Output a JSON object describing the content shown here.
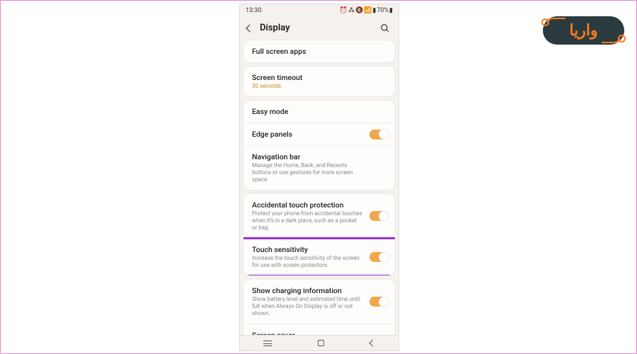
{
  "logo_text": "واریا",
  "status": {
    "time": "13:30",
    "battery": "70%"
  },
  "header": {
    "title": "Display"
  },
  "groups": [
    {
      "rows": [
        {
          "title": "Full screen apps"
        }
      ]
    },
    {
      "rows": [
        {
          "title": "Screen timeout",
          "sub": "30 seconds",
          "sub_accent": true
        }
      ]
    },
    {
      "rows": [
        {
          "title": "Easy mode"
        },
        {
          "title": "Edge panels",
          "toggle": true
        },
        {
          "title": "Navigation bar",
          "sub": "Manage the Home, Back, and Recents buttons or use gestures for more screen space."
        }
      ]
    },
    {
      "rows": [
        {
          "title": "Accidental touch protection",
          "sub": "Protect your phone from accidental touches when it's in a dark place, such as a pocket or bag.",
          "toggle": true
        },
        {
          "title": "Touch sensitivity",
          "sub": "Increase the touch sensitivity of the screen for use with screen protectors.",
          "toggle": true,
          "highlight": true
        }
      ]
    },
    {
      "rows": [
        {
          "title": "Show charging information",
          "sub": "Show battery level and estimated time until full when Always On Display is off or not shown.",
          "toggle": true
        },
        {
          "title": "Screen saver"
        }
      ]
    }
  ]
}
